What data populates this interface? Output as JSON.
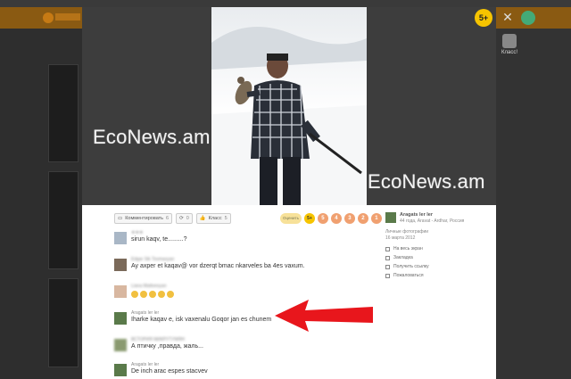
{
  "watermark": "EcoNews.am",
  "overlay": {
    "badge": "5+",
    "close_glyph": "✕",
    "klass_label": "Класс!"
  },
  "actions": [
    {
      "label": "Комментировать",
      "count": "6"
    },
    {
      "label": "⟳",
      "count": "0"
    },
    {
      "label": "Класс",
      "count": "5"
    }
  ],
  "rating": {
    "label": "Оценить",
    "values": [
      "5+",
      "5",
      "4",
      "3",
      "2",
      "1"
    ]
  },
  "comments": [
    {
      "name": "★★★",
      "text": "sirun kaqv, te.........?",
      "avatar_color": "#a9b7c6",
      "blurred_name": true
    },
    {
      "name": "Edgar Sik Tovmasyan",
      "text": "Ay axper et kaqav@ vor dzerqt bmac nkarveles ba 4es vaxum.",
      "avatar_color": "#7b6a5a",
      "blurred_name": true
    },
    {
      "name": "Liana Mattoesyan",
      "text": "",
      "avatar_color": "#d8b7a0",
      "blurred_name": true,
      "emoji_count": 5
    },
    {
      "name": "Aragats ler ler",
      "text": "Iharke kaqav e, isk vaxenalu Goqor jan es  chunem",
      "avatar_color": "#5a7a4a",
      "blurred_name": false
    },
    {
      "name": "ВСТОРИЯ МИКРУТУМЯН",
      "text": "А птичку ,правда, жаль...",
      "avatar_color": "#8a9a70",
      "blurred_name": true,
      "blurred_avatar": true
    },
    {
      "name": "Aragats ler ler",
      "text": "De inch arac espes stacvev",
      "avatar_color": "#5a7a4a",
      "blurred_name": false
    }
  ],
  "author": {
    "name": "Aragats ler ler",
    "details": "44 года, Aravat - Ardhar, Россия",
    "album": "Личные фотографии",
    "date": "16 марта 2012"
  },
  "side_links": [
    "На весь экран",
    "Закладка",
    "Получить ссылку",
    "Пожаловаться"
  ],
  "colors": {
    "arrow": "#e8161c",
    "badge": "#f6c400",
    "rating": "#f0a070"
  }
}
